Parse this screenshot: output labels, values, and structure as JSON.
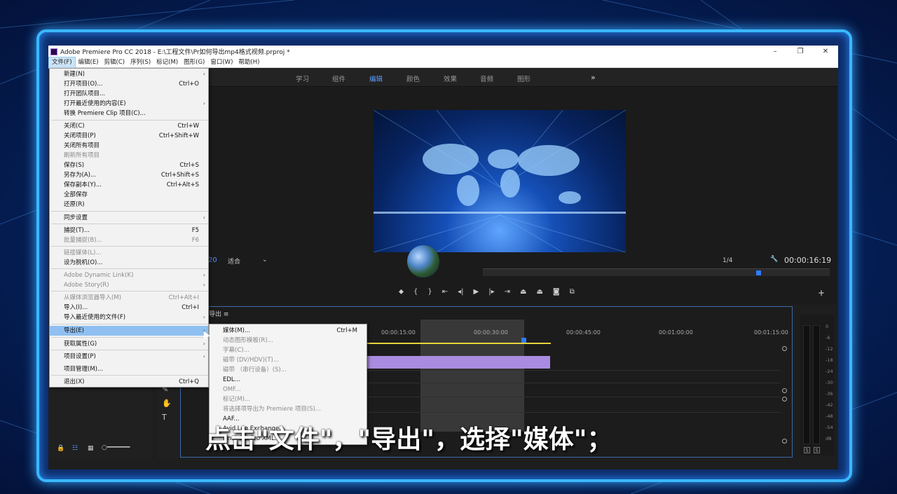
{
  "window": {
    "title": "Adobe Premiere Pro CC 2018 - E:\\工程文件\\Pr如何导出mp4格式视频.prproj *",
    "minimize": "–",
    "restore": "❐",
    "close": "✕"
  },
  "menubar": [
    "文件(F)",
    "编辑(E)",
    "剪辑(C)",
    "序列(S)",
    "标记(M)",
    "图形(G)",
    "窗口(W)",
    "帮助(H)"
  ],
  "workspaces": {
    "tabs": [
      "学习",
      "组件",
      "编辑",
      "颜色",
      "效果",
      "音频",
      "图形"
    ],
    "active": "编辑",
    "more": "»"
  },
  "program": {
    "fit_label": "适合",
    "resolution": "1/4",
    "timecode": "00:00:16:19",
    "left_timecode_fragment": "20"
  },
  "timeline": {
    "title": "导出 ≡",
    "ruler": [
      "00:00:15:00",
      "00:00:30:00",
      "00:00:45:00",
      "00:01:00:00",
      "00:01:15:00"
    ]
  },
  "meter": {
    "labels": [
      "0",
      "-6",
      "-12",
      "-18",
      "-24",
      "-30",
      "-36",
      "-42",
      "-48",
      "-54",
      "dB"
    ],
    "solo": [
      "S",
      "S"
    ]
  },
  "file_menu": [
    {
      "label": "新建(N)",
      "shortcut": "",
      "submenu": true,
      "disabled": false
    },
    {
      "label": "打开项目(O)...",
      "shortcut": "Ctrl+O",
      "submenu": false,
      "disabled": false
    },
    {
      "label": "打开团队项目...",
      "shortcut": "",
      "submenu": false,
      "disabled": false
    },
    {
      "label": "打开最近使用的内容(E)",
      "shortcut": "",
      "submenu": true,
      "disabled": false
    },
    {
      "label": "转换 Premiere Clip 项目(C)...",
      "shortcut": "",
      "submenu": false,
      "disabled": false
    },
    {
      "label": "关闭(C)",
      "shortcut": "Ctrl+W",
      "submenu": false,
      "disabled": false
    },
    {
      "label": "关闭项目(P)",
      "shortcut": "Ctrl+Shift+W",
      "submenu": false,
      "disabled": false
    },
    {
      "label": "关闭所有项目",
      "shortcut": "",
      "submenu": false,
      "disabled": false
    },
    {
      "label": "刷新所有项目",
      "shortcut": "",
      "submenu": false,
      "disabled": true
    },
    {
      "label": "保存(S)",
      "shortcut": "Ctrl+S",
      "submenu": false,
      "disabled": false
    },
    {
      "label": "另存为(A)...",
      "shortcut": "Ctrl+Shift+S",
      "submenu": false,
      "disabled": false
    },
    {
      "label": "保存副本(Y)...",
      "shortcut": "Ctrl+Alt+S",
      "submenu": false,
      "disabled": false
    },
    {
      "label": "全部保存",
      "shortcut": "",
      "submenu": false,
      "disabled": false
    },
    {
      "label": "还原(R)",
      "shortcut": "",
      "submenu": false,
      "disabled": false
    },
    {
      "label": "同步设置",
      "shortcut": "",
      "submenu": true,
      "disabled": false
    },
    {
      "label": "捕捉(T)...",
      "shortcut": "F5",
      "submenu": false,
      "disabled": false
    },
    {
      "label": "批量捕捉(B)...",
      "shortcut": "F6",
      "submenu": false,
      "disabled": true
    },
    {
      "label": "链接媒体(L)...",
      "shortcut": "",
      "submenu": false,
      "disabled": true
    },
    {
      "label": "设为脱机(O)...",
      "shortcut": "",
      "submenu": false,
      "disabled": false
    },
    {
      "label": "Adobe Dynamic Link(K)",
      "shortcut": "",
      "submenu": true,
      "disabled": true
    },
    {
      "label": "Adobe Story(R)",
      "shortcut": "",
      "submenu": true,
      "disabled": true
    },
    {
      "label": "从媒体浏览器导入(M)",
      "shortcut": "Ctrl+Alt+I",
      "submenu": false,
      "disabled": true
    },
    {
      "label": "导入(I)...",
      "shortcut": "Ctrl+I",
      "submenu": false,
      "disabled": false
    },
    {
      "label": "导入最近使用的文件(F)",
      "shortcut": "",
      "submenu": true,
      "disabled": false
    },
    {
      "label": "导出(E)",
      "shortcut": "",
      "submenu": true,
      "disabled": false,
      "highlighted": true
    },
    {
      "label": "获取属性(G)",
      "shortcut": "",
      "submenu": true,
      "disabled": false
    },
    {
      "label": "项目设置(P)",
      "shortcut": "",
      "submenu": true,
      "disabled": false
    },
    {
      "label": "项目管理(M)...",
      "shortcut": "",
      "submenu": false,
      "disabled": false
    },
    {
      "label": "退出(X)",
      "shortcut": "Ctrl+Q",
      "submenu": false,
      "disabled": false
    }
  ],
  "export_submenu": [
    {
      "label": "媒体(M)...",
      "shortcut": "Ctrl+M",
      "disabled": false
    },
    {
      "label": "动态图形模板(R)...",
      "shortcut": "",
      "disabled": true
    },
    {
      "label": "字幕(C)...",
      "shortcut": "",
      "disabled": true
    },
    {
      "label": "磁带 (DV/HDV)(T)...",
      "shortcut": "",
      "disabled": true
    },
    {
      "label": "磁带 （串行设备）(S)...",
      "shortcut": "",
      "disabled": true
    },
    {
      "label": "EDL...",
      "shortcut": "",
      "disabled": false
    },
    {
      "label": "OMF...",
      "shortcut": "",
      "disabled": true
    },
    {
      "label": "标记(M)...",
      "shortcut": "",
      "disabled": true
    },
    {
      "label": "将选择项导出为 Premiere 项目(S)...",
      "shortcut": "",
      "disabled": true
    },
    {
      "label": "AAF...",
      "shortcut": "",
      "disabled": false
    },
    {
      "label": "Avid Log Exchange...",
      "shortcut": "",
      "disabled": false
    },
    {
      "label": "Final Cut Pro XML...",
      "shortcut": "",
      "disabled": false
    }
  ],
  "caption": "点击\"文件\"，\"导出\"，选择\"媒体\"；"
}
